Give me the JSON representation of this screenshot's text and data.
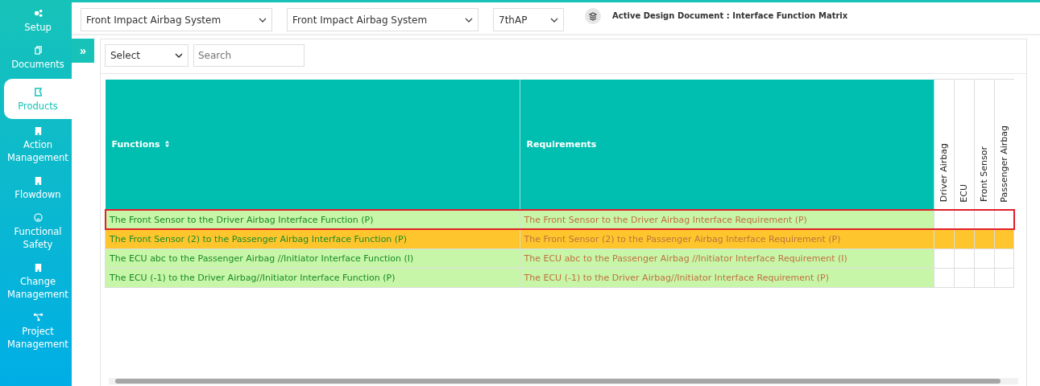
{
  "sidebar": {
    "items": [
      {
        "label": "Setup",
        "selected": false
      },
      {
        "label": "Documents",
        "selected": false
      },
      {
        "label": "Products",
        "selected": true
      },
      {
        "label": "Action Management",
        "selected": false
      },
      {
        "label": "Flowdown",
        "selected": false
      },
      {
        "label": "Functional Safety",
        "selected": false
      },
      {
        "label": "Change Management",
        "selected": false
      },
      {
        "label": "Project Management",
        "selected": false
      }
    ]
  },
  "toolbar": {
    "focus_element": "Front Impact Airbag System",
    "context_element": "Front Impact Airbag System",
    "format": "7thAP",
    "active_document": "Active Design Document : Interface Function Matrix"
  },
  "expand_button": "»",
  "filter": {
    "select": "Select",
    "search_placeholder": "Search"
  },
  "table": {
    "columns": [
      {
        "label": "Functions",
        "sortable": true
      },
      {
        "label": "Requirements",
        "sortable": false
      }
    ],
    "matrix_columns": [
      "Driver Airbag",
      "ECU",
      "Front Sensor",
      "Passenger Airbag"
    ],
    "rows": [
      {
        "function": "The Front Sensor to the Driver Airbag Interface Function (P)",
        "requirement": "The Front Sensor to the Driver Airbag Interface Requirement (P)",
        "selected": true,
        "highlighted": false
      },
      {
        "function": "The Front Sensor (2) to the Passenger Airbag Interface Function (P)",
        "requirement": "The Front Sensor (2) to the Passenger Airbag Interface Requirement (P)",
        "selected": false,
        "highlighted": true
      },
      {
        "function": "The ECU abc to the Passenger Airbag //Initiator Interface Function (I)",
        "requirement": "The ECU abc to the Passenger Airbag //Initiator Interface Requirement (I)",
        "selected": false,
        "highlighted": false
      },
      {
        "function": "The ECU (-1) to the Driver Airbag//Initiator Interface Function (P)",
        "requirement": "The ECU (-1) to the Driver Airbag//Initiator Interface Requirement (P)",
        "selected": false,
        "highlighted": false
      }
    ]
  }
}
